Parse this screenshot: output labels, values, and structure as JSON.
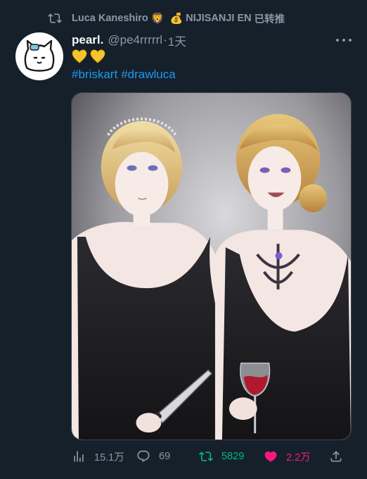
{
  "retweet_context": {
    "icon": "retweet-icon",
    "user": "Luca Kaneshiro",
    "emoji_1": "🦁",
    "emoji_2": "💰",
    "org": "NIJISANJI EN",
    "suffix": "已转推"
  },
  "tweet": {
    "author_name": "pearl.",
    "author_handle": "@pe4rrrrrl",
    "separator": "·",
    "time": "1天",
    "text_emojis": [
      "💛",
      "💛"
    ],
    "hashtags": [
      "#briskart",
      "#drawluca"
    ],
    "media_alt": "Illustration of two blonde characters in black dresses"
  },
  "actions": {
    "views": "15.1万",
    "replies": "69",
    "retweets": "5829",
    "likes": "2.2万"
  },
  "colors": {
    "background": "#15202b",
    "text": "#f7f9f9",
    "muted": "#8b98a5",
    "link": "#1d9bf0",
    "retweet": "#00ba7c",
    "like": "#f91880"
  }
}
